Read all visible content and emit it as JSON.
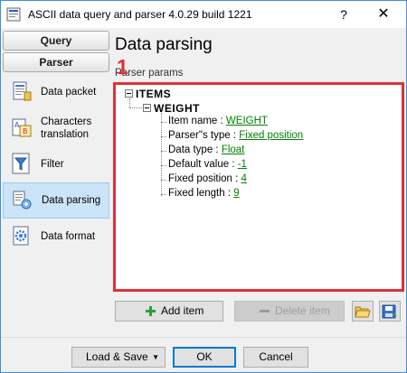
{
  "window": {
    "title": "ASCII data query and parser 4.0.29 build 1221",
    "help": "?",
    "close": "✕"
  },
  "nav": {
    "header_query": "Query",
    "header_parser": "Parser",
    "items": [
      {
        "label": "Data packet",
        "icon": "data-packet-icon"
      },
      {
        "label": "Characters translation",
        "icon": "characters-translation-icon"
      },
      {
        "label": "Filter",
        "icon": "funnel-icon"
      },
      {
        "label": "Data parsing",
        "icon": "data-parsing-icon",
        "selected": true
      },
      {
        "label": "Data format",
        "icon": "gear-icon"
      }
    ]
  },
  "main": {
    "title": "Data parsing",
    "section_label": "Parser params",
    "badge": "1",
    "tree": {
      "root": "ITEMS",
      "child": "WEIGHT",
      "props": [
        {
          "label": "Item name : ",
          "value": "WEIGHT"
        },
        {
          "label": "Parser\"s type : ",
          "value": "Fixed position"
        },
        {
          "label": "Data type : ",
          "value": "Float"
        },
        {
          "label": "Default value : ",
          "value": "-1"
        },
        {
          "label": "Fixed position : ",
          "value": "4"
        },
        {
          "label": "Fixed length : ",
          "value": "9"
        }
      ]
    },
    "add_item": "Add item",
    "delete_item": "Delete item"
  },
  "footer": {
    "load_save": "Load & Save",
    "ok": "OK",
    "cancel": "Cancel"
  },
  "colors": {
    "highlight_border": "#e0303a",
    "value_link": "#008000",
    "selected_bg": "#cce4f7"
  }
}
